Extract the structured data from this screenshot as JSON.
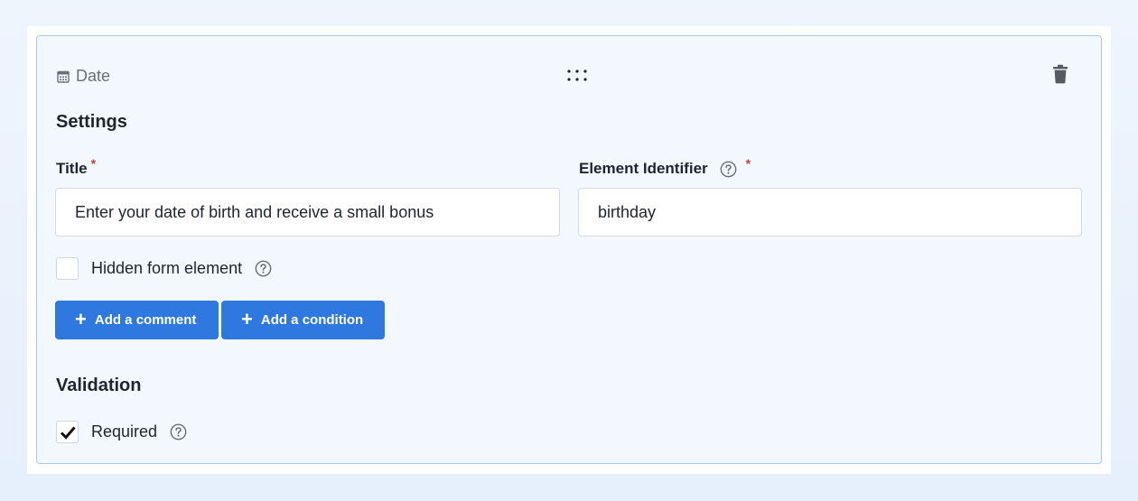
{
  "element": {
    "type_label": "Date",
    "type_icon": "calendar-icon"
  },
  "settings": {
    "heading": "Settings",
    "title_field": {
      "label": "Title",
      "required_mark": "*",
      "value": "Enter your date of birth and receive a small bonus"
    },
    "identifier_field": {
      "label": "Element Identifier",
      "required_mark": "*",
      "value": "birthday"
    },
    "hidden_checkbox": {
      "label": "Hidden form element",
      "checked": false
    },
    "buttons": {
      "add_comment": "Add a comment",
      "add_condition": "Add a condition",
      "plus_glyph": "+"
    }
  },
  "validation": {
    "heading": "Validation",
    "required_checkbox": {
      "label": "Required",
      "checked": true
    }
  },
  "colors": {
    "accent": "#2f78e0",
    "card_border": "#a9c8ee",
    "card_bg": "#f3f8fe",
    "required_star": "#d23c3c"
  }
}
